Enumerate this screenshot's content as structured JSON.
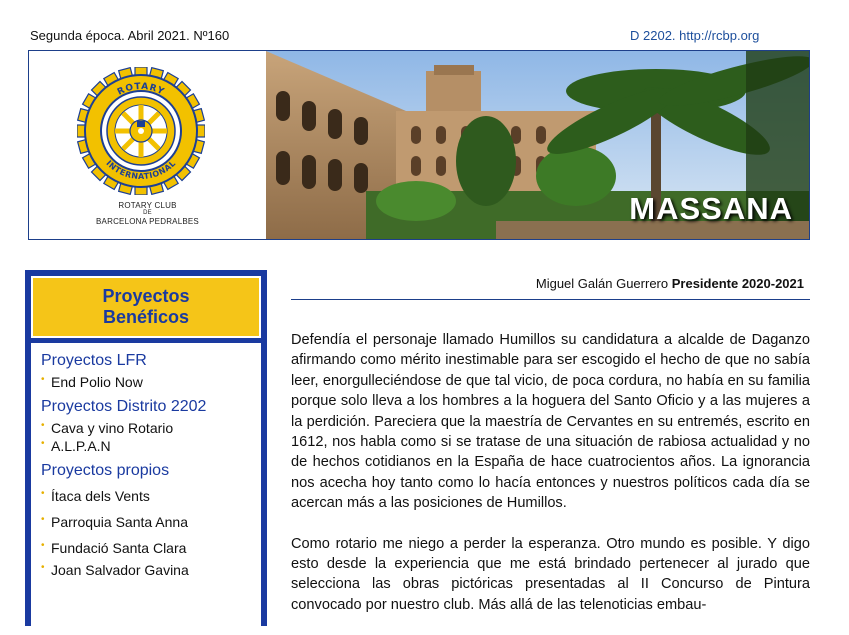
{
  "header": {
    "issue": "Segunda época. Abril 2021. Nº160",
    "district": "D 2202. http://rcbp.org"
  },
  "logo": {
    "ring_text_top": "ROTARY",
    "ring_text_bottom": "INTERNATIONAL",
    "club_line1": "ROTARY CLUB",
    "club_line2": "DE",
    "club_line3": "BARCELONA PEDRALBES",
    "colors": {
      "gold": "#f2c100",
      "blue": "#1c3f94"
    }
  },
  "banner": {
    "title": "MASSANA"
  },
  "sidebar": {
    "title_line1": "Proyectos",
    "title_line2": "Benéficos",
    "sections": [
      {
        "heading": "Proyectos LFR",
        "items": [
          "End Polio Now"
        ]
      },
      {
        "heading": "Proyectos Distrito 2202",
        "items": [
          "Cava y vino Rotario",
          "A.L.P.A.N"
        ]
      },
      {
        "heading": "Proyectos propios",
        "items": [
          "Ítaca dels Vents",
          "Parroquia Santa Anna",
          "Fundació Santa Clara",
          "Joan Salvador Gavina"
        ]
      }
    ],
    "colors": {
      "accent": "#1a3aa0",
      "title_bg": "#f5c518"
    }
  },
  "article": {
    "author": "Miguel Galán Guerrero",
    "role": "Presidente 2020-2021",
    "paragraphs": [
      "Defendía el personaje llamado Humillos su candidatura a alcalde de Daganzo afirmando como mérito inestimable para ser escogido el hecho de que no sabía leer, enorgulleciéndose de que tal vicio, de poca cordura, no había en su familia porque solo lleva a los hombres a la hoguera del Santo Oficio y a las mujeres a la perdición. Pareciera que la maestría de Cervantes en su entremés, escrito en 1612, nos habla como si se tratase de una situación de rabiosa actualidad y no de hechos cotidianos en la España de hace cuatrocientos años. La ignorancia nos acecha hoy tanto como lo hacía entonces y nuestros políticos cada día se acercan más a las posiciones de Humillos.",
      "Como rotario me niego a perder la esperanza. Otro mundo es posible. Y digo esto desde la experiencia que me está brindado pertenecer al jurado que selecciona las obras pictóricas presentadas al II Concurso de Pintura convocado por nuestro club. Más allá de las telenoticias embau-"
    ]
  }
}
